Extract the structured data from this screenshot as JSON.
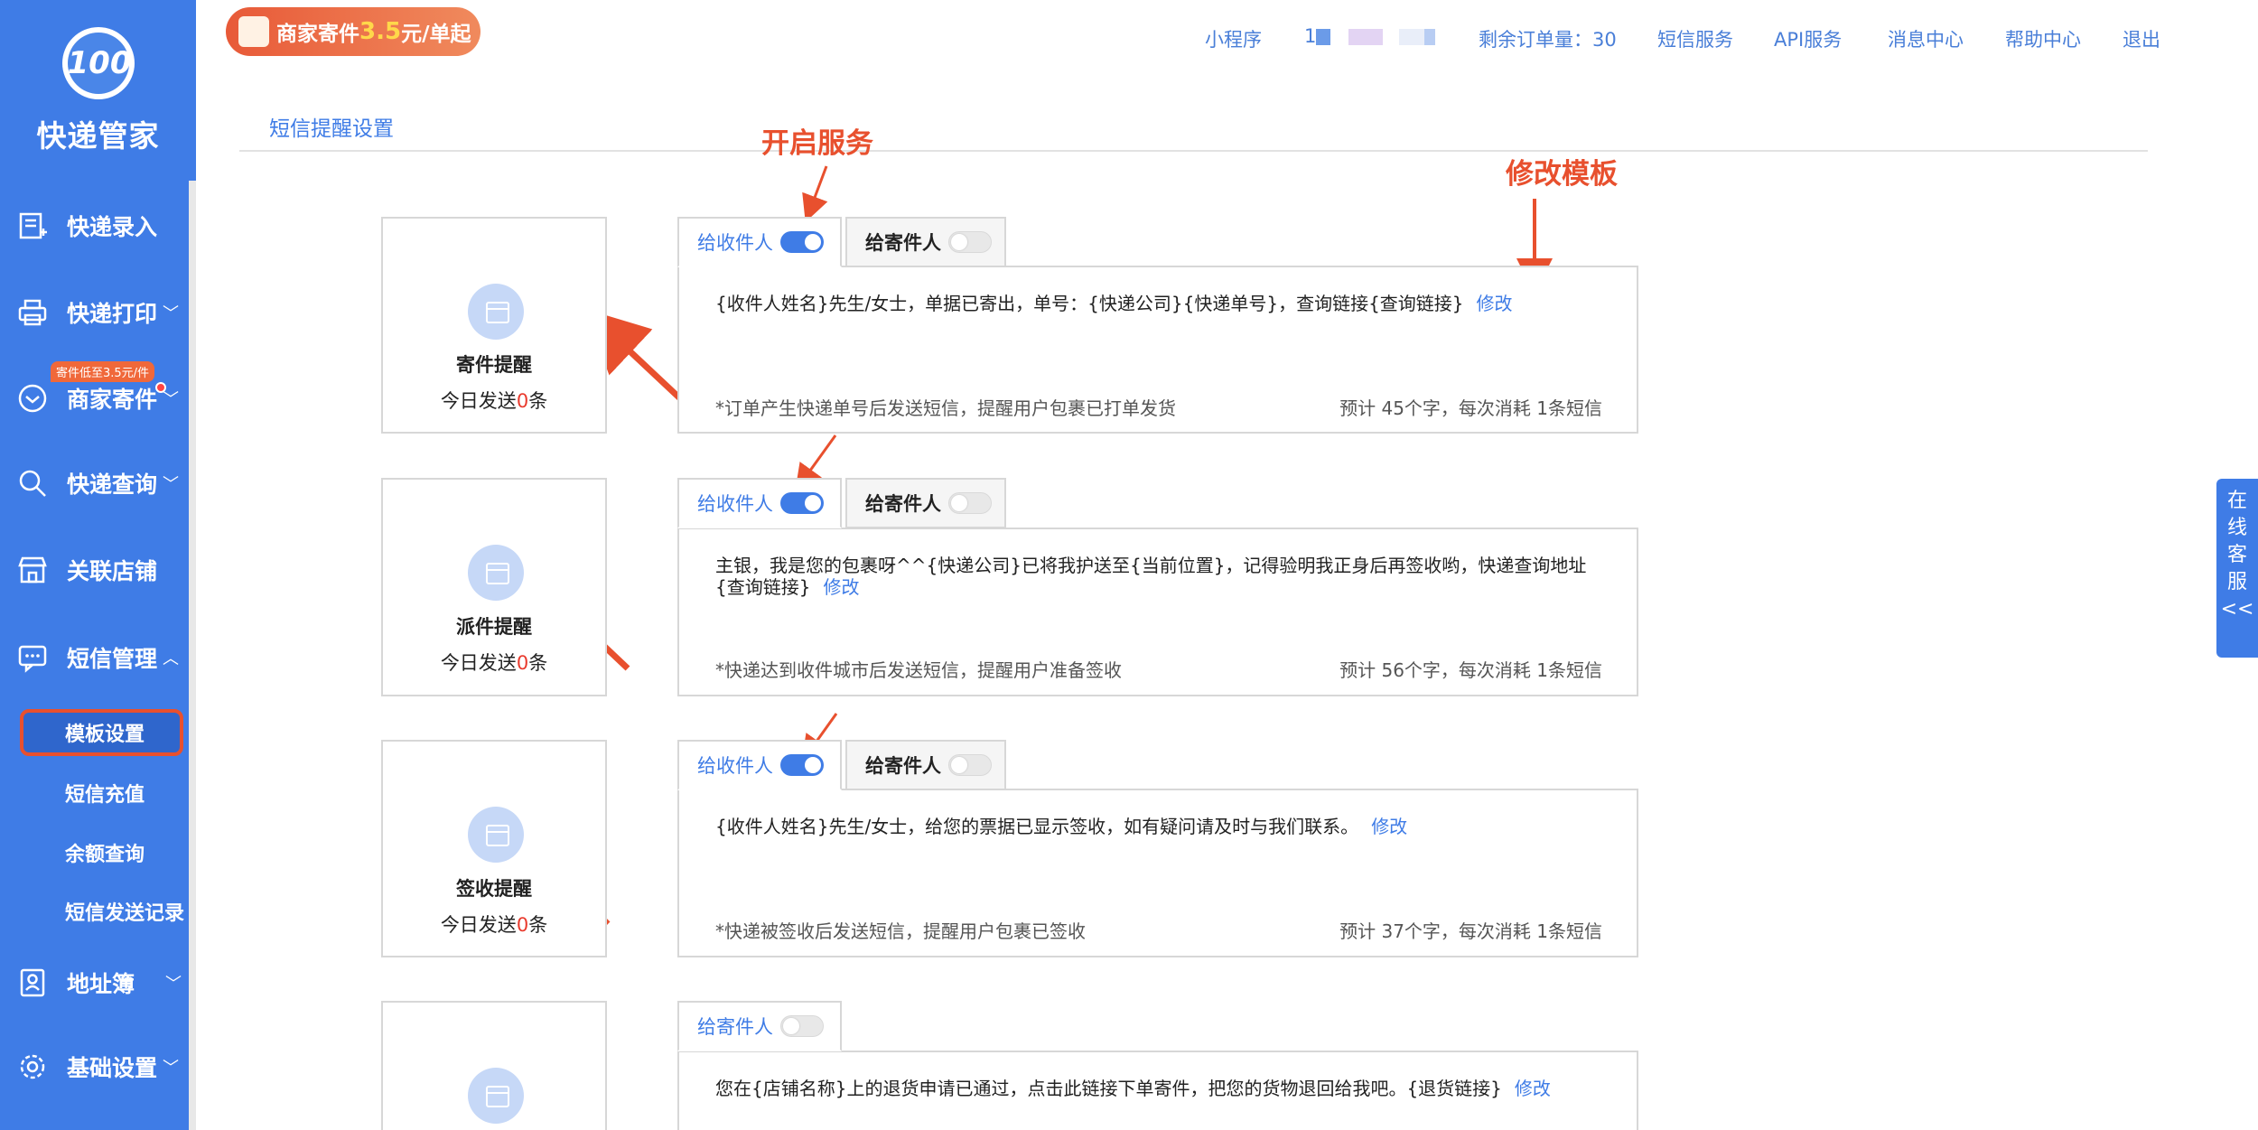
{
  "app": {
    "name": "快递管家",
    "logo_text": "100",
    "logo_sub": "管家"
  },
  "promo": {
    "label": "商家寄件",
    "price": "3.5",
    "suffix": "元/单起"
  },
  "topnav": {
    "miniprogram": "小程序",
    "account_prefix": "1",
    "remaining_label": "剩余订单量：",
    "remaining_value": "30",
    "sms_service": "短信服务",
    "api_service": "API服务",
    "message_center": "消息中心",
    "help_center": "帮助中心",
    "logout": "退出"
  },
  "sidebar": {
    "items": [
      {
        "label": "快递录入",
        "icon": "entry-icon"
      },
      {
        "label": "快递打印",
        "icon": "printer-icon"
      },
      {
        "label": "商家寄件",
        "icon": "shipping-icon"
      },
      {
        "label": "快递查询",
        "icon": "search-icon"
      },
      {
        "label": "关联店铺",
        "icon": "store-icon"
      },
      {
        "label": "短信管理",
        "icon": "message-icon"
      },
      {
        "label": "地址簿",
        "icon": "address-book-icon"
      },
      {
        "label": "基础设置",
        "icon": "gear-icon"
      }
    ],
    "badge": "寄件低至3.5元/件",
    "sms_subitems": [
      "模板设置",
      "短信充值",
      "余额查询",
      "短信发送记录"
    ]
  },
  "page": {
    "title": "短信提醒设置"
  },
  "annotations": {
    "enable_service": "开启服务",
    "edit_template": "修改模板"
  },
  "tabs": {
    "to_receiver": "给收件人",
    "to_sender": "给寄件人"
  },
  "common": {
    "today_prefix": "今日发送",
    "today_suffix": "条",
    "edit": "修改"
  },
  "reminders": [
    {
      "name": "寄件提醒",
      "today_count": "0",
      "receiver_on": true,
      "sender_on": false,
      "template": "{收件人姓名}先生/女士，单据已寄出，单号：{快递公司}{快递单号}，查询链接{查询链接}",
      "note": "*订单产生快递单号后发送短信，提醒用户包裹已打单发货",
      "estimate": "预计 45个字，每次消耗 1条短信"
    },
    {
      "name": "派件提醒",
      "today_count": "0",
      "receiver_on": true,
      "sender_on": false,
      "template": "主银，我是您的包裹呀^^{快递公司}已将我护送至{当前位置}，记得验明我正身后再签收哟，快递查询地址{查询链接}",
      "note": "*快递达到收件城市后发送短信，提醒用户准备签收",
      "estimate": "预计 56个字，每次消耗 1条短信"
    },
    {
      "name": "签收提醒",
      "today_count": "0",
      "receiver_on": true,
      "sender_on": false,
      "template": "{收件人姓名}先生/女士，给您的票据已显示签收，如有疑问请及时与我们联系。",
      "note": "*快递被签收后发送短信，提醒用户包裹已签收",
      "estimate": "预计 37个字，每次消耗 1条短信"
    },
    {
      "name": "",
      "today_count": "",
      "receiver_on": false,
      "sender_on": false,
      "template": "您在{店铺名称}上的退货申请已通过，点击此链接下单寄件，把您的货物退回给我吧。{退货链接}",
      "note": "",
      "estimate": ""
    }
  ],
  "customer_service": {
    "label": "在线客服",
    "chars": [
      "在",
      "线",
      "客",
      "服"
    ],
    "arrow": "<<"
  },
  "colors": {
    "primary": "#3f7ce6",
    "annotation": "#e8502e",
    "zero": "#e93b2e"
  }
}
